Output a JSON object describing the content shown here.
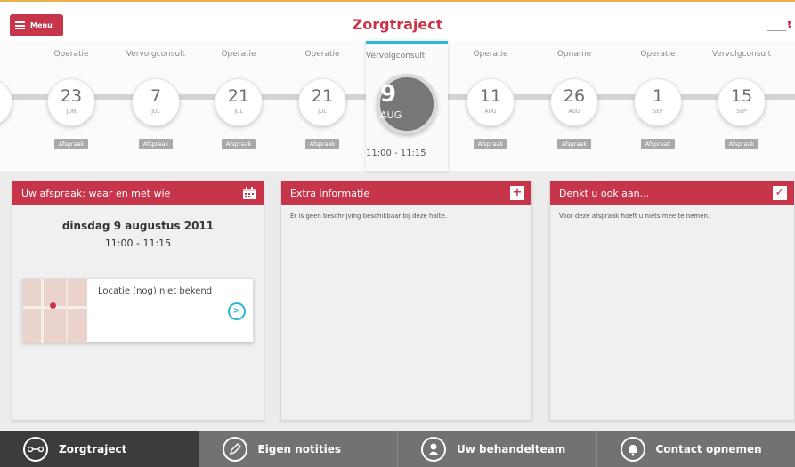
{
  "header": {
    "menu_label": "Menu",
    "title": "Zorgtraject"
  },
  "timeline": {
    "items": [
      {
        "type": "Operatie",
        "day": "23",
        "month": "JUN",
        "badge": "Afspraak"
      },
      {
        "type": "Vervolgconsult",
        "day": "7",
        "month": "JUL",
        "badge": "Afspraak"
      },
      {
        "type": "Operatie",
        "day": "21",
        "month": "JUL",
        "badge": "Afspraak"
      },
      {
        "type": "Operatie",
        "day": "21",
        "month": "JUL",
        "badge": "Afspraak"
      },
      {
        "type": "Operatie",
        "day": "11",
        "month": "AUG",
        "badge": "Afspraak"
      },
      {
        "type": "Opname",
        "day": "26",
        "month": "AUG",
        "badge": "Afspraak"
      },
      {
        "type": "Operatie",
        "day": "1",
        "month": "SEP",
        "badge": "Afspraak"
      },
      {
        "type": "Vervolgconsult",
        "day": "15",
        "month": "SEP",
        "badge": "Afspraak"
      }
    ],
    "selected": {
      "type": "Vervolgconsult",
      "day": "9",
      "month": "AUG",
      "time": "11:00 - 11:15"
    }
  },
  "panels": {
    "appointment": {
      "title": "Uw afspraak: waar en met wie",
      "date": "dinsdag 9 augustus 2011",
      "time": "11:00 - 11:15",
      "location": "Locatie (nog) niet bekend"
    },
    "extra": {
      "title": "Extra informatie",
      "text": "Er is geen beschrijving beschikbaar bij deze halte."
    },
    "reminder": {
      "title": "Denkt u ook aan...",
      "text": "Voor deze afspraak hoeft u niets mee te nemen."
    }
  },
  "bottom_nav": [
    {
      "label": "Zorgtraject",
      "icon": "route-icon"
    },
    {
      "label": "Eigen notities",
      "icon": "pencil-icon"
    },
    {
      "label": "Uw behandelteam",
      "icon": "person-icon"
    },
    {
      "label": "Contact opnemen",
      "icon": "bell-icon"
    }
  ],
  "colors": {
    "accent": "#c7354b",
    "highlight": "#2fb7d8",
    "nav_bg": "#727272",
    "nav_active": "#3c3c3c"
  }
}
